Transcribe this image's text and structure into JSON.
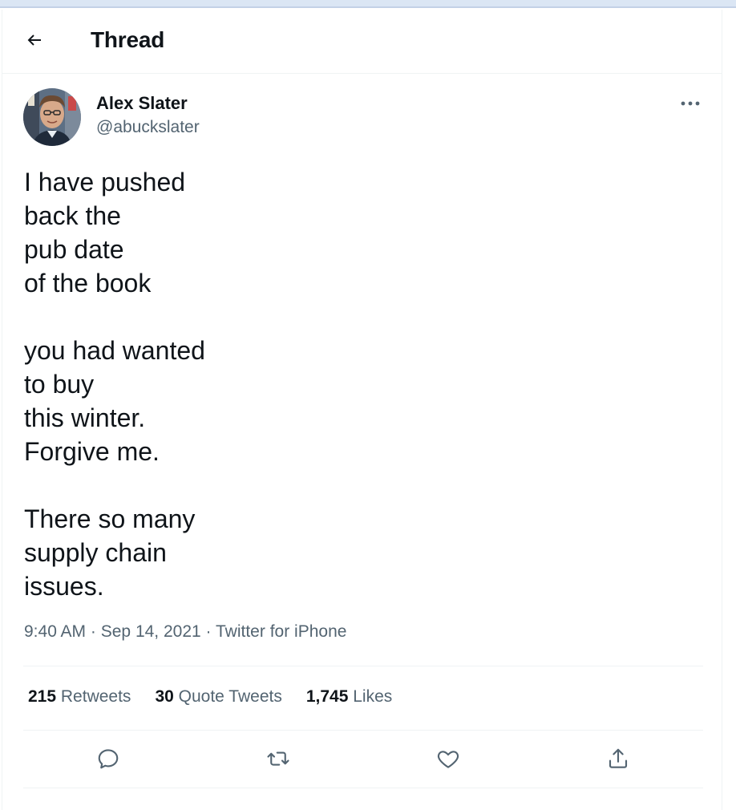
{
  "header": {
    "title": "Thread",
    "back_icon": "arrow-left-icon"
  },
  "tweet": {
    "author": {
      "name": "Alex Slater",
      "handle": "@abuckslater"
    },
    "more_icon": "more-horizontal-icon",
    "text": "I have pushed\nback the\npub date\nof the book\n\nyou had wanted\nto buy\nthis winter.\nForgive me.\n\nThere so many\nsupply chain\nissues.",
    "time": "9:40 AM",
    "separator": "·",
    "date": "Sep 14, 2021",
    "source": "Twitter for iPhone"
  },
  "stats": {
    "retweets": {
      "count": "215",
      "label": "Retweets"
    },
    "quotes": {
      "count": "30",
      "label": "Quote Tweets"
    },
    "likes": {
      "count": "1,745",
      "label": "Likes"
    }
  },
  "actions": [
    "reply-icon",
    "retweet-icon",
    "like-icon",
    "share-icon"
  ],
  "colors": {
    "text": "#0f1419",
    "secondary": "#536471",
    "border": "#eff3f4"
  }
}
